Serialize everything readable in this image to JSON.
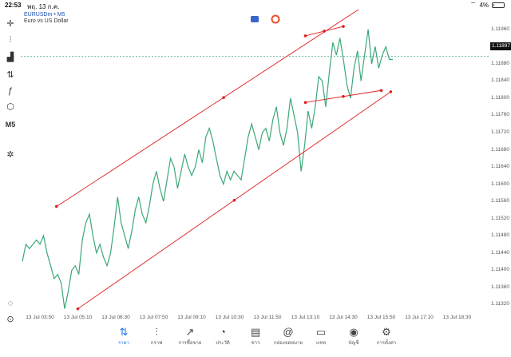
{
  "status_bar": {
    "time": "22:53",
    "date": "พฤ. 13 ก.ค.",
    "battery": "4%"
  },
  "symbol": {
    "name": "EURUSDm • M5",
    "description": "Euro vs US Dollar"
  },
  "timeframe": "M5",
  "current_price": "1.11897",
  "price_axis": [
    "1.11960",
    "1.11920",
    "1.11880",
    "1.11840",
    "1.11800",
    "1.11760",
    "1.11720",
    "1.11680",
    "1.11640",
    "1.11600",
    "1.11560",
    "1.11520",
    "1.11480",
    "1.11440",
    "1.11400",
    "1.11360",
    "1.11320"
  ],
  "time_axis": [
    "13 Jul 03:50",
    "13 Jul 05:10",
    "13 Jul 06:30",
    "13 Jul 07:50",
    "13 Jul 09:10",
    "13 Jul 10:30",
    "13 Jul 11:50",
    "13 Jul 13:10",
    "13 Jul 14:30",
    "13 Jul 15:50",
    "13 Jul 17:10",
    "13 Jul 18:30"
  ],
  "colors": {
    "line": "#3aa876",
    "trendline": "#e02020",
    "price_level": "#3aa876",
    "nav_active": "#1e74e6"
  },
  "chart_data": {
    "type": "line",
    "y_range": [
      1.113,
      1.11995
    ],
    "x_labels": [
      "13 Jul 03:50",
      "13 Jul 05:10",
      "13 Jul 06:30",
      "13 Jul 07:50",
      "13 Jul 09:10",
      "13 Jul 10:30",
      "13 Jul 11:50",
      "13 Jul 13:10",
      "13 Jul 14:30",
      "13 Jul 15:50",
      "13 Jul 17:10",
      "13 Jul 18:30"
    ],
    "values": [
      1.1142,
      1.1146,
      1.1145,
      1.1146,
      1.1147,
      1.1146,
      1.1148,
      1.1144,
      1.1141,
      1.1138,
      1.1139,
      1.1137,
      1.1131,
      1.1135,
      1.114,
      1.1141,
      1.1139,
      1.1147,
      1.1151,
      1.1153,
      1.1148,
      1.1144,
      1.1146,
      1.1143,
      1.1141,
      1.1144,
      1.115,
      1.1157,
      1.1151,
      1.1148,
      1.1145,
      1.1149,
      1.1154,
      1.1157,
      1.1153,
      1.1151,
      1.1155,
      1.116,
      1.1163,
      1.1159,
      1.1156,
      1.1161,
      1.1166,
      1.1164,
      1.1159,
      1.1163,
      1.1167,
      1.1164,
      1.1162,
      1.1164,
      1.1168,
      1.1165,
      1.1171,
      1.1173,
      1.117,
      1.1166,
      1.1162,
      1.116,
      1.1163,
      1.1161,
      1.1163,
      1.1162,
      1.1161,
      1.1166,
      1.1171,
      1.1174,
      1.1171,
      1.1168,
      1.1172,
      1.1173,
      1.117,
      1.1175,
      1.1178,
      1.1172,
      1.1169,
      1.1173,
      1.118,
      1.1176,
      1.1172,
      1.1163,
      1.1169,
      1.1177,
      1.1173,
      1.1178,
      1.1185,
      1.1184,
      1.1178,
      1.1186,
      1.1193,
      1.119,
      1.1194,
      1.1189,
      1.1183,
      1.118,
      1.1187,
      1.1191,
      1.1184,
      1.119,
      1.1196,
      1.1188,
      1.1192,
      1.1187,
      1.119,
      1.1192,
      1.1189,
      1.1189
    ],
    "current_value": 1.11897,
    "trendlines": [
      {
        "p1": [
          "13 Jul 04:25",
          1.11548
        ],
        "p2": [
          "13 Jul 16:10",
          1.12055
        ]
      },
      {
        "p1": [
          "13 Jul 05:10",
          1.1131
        ],
        "p2": [
          "13 Jul 16:10",
          1.11815
        ]
      },
      {
        "p1": [
          "13 Jul 13:10",
          1.11945
        ],
        "p2": [
          "13 Jul 14:30",
          1.11967
        ]
      },
      {
        "p1": [
          "13 Jul 13:10",
          1.1179
        ],
        "p2": [
          "13 Jul 15:50",
          1.11818
        ]
      }
    ]
  },
  "toolbar": [
    {
      "icon": "crosshair-icon",
      "glyph": "✛"
    },
    {
      "icon": "candles-icon",
      "glyph": "⫶"
    },
    {
      "icon": "indicators-icon",
      "glyph": "▟"
    },
    {
      "icon": "objects-icon",
      "glyph": "⇅"
    },
    {
      "icon": "function-icon",
      "glyph": "ƒ"
    },
    {
      "icon": "shapes-icon",
      "glyph": "⬡"
    },
    {
      "icon": "timeframe-label",
      "glyph": "M5"
    },
    {
      "icon": "magic-icon",
      "glyph": "✲"
    }
  ],
  "bottom_nav": [
    {
      "label": "ราคา",
      "icon": "quotes-icon",
      "glyph": "⇅",
      "active": true
    },
    {
      "label": "กราฟ",
      "icon": "chart-icon",
      "glyph": "⫶",
      "active": false
    },
    {
      "label": "การซื้อขาย",
      "icon": "trade-icon",
      "glyph": "↗",
      "active": false
    },
    {
      "label": "ประวัติ",
      "icon": "history-icon",
      "glyph": "◔",
      "active": false
    },
    {
      "label": "ข่าว",
      "icon": "news-icon",
      "glyph": "▤",
      "active": false
    },
    {
      "label": "กล่องจดหมาย",
      "icon": "mailbox-icon",
      "glyph": "@",
      "active": false
    },
    {
      "label": "แชท",
      "icon": "chat-icon",
      "glyph": "▭",
      "active": false
    },
    {
      "label": "บัญชี",
      "icon": "account-icon",
      "glyph": "◉",
      "active": false
    },
    {
      "label": "การตั้งค่า",
      "icon": "settings-icon",
      "glyph": "⚙",
      "active": false
    }
  ]
}
